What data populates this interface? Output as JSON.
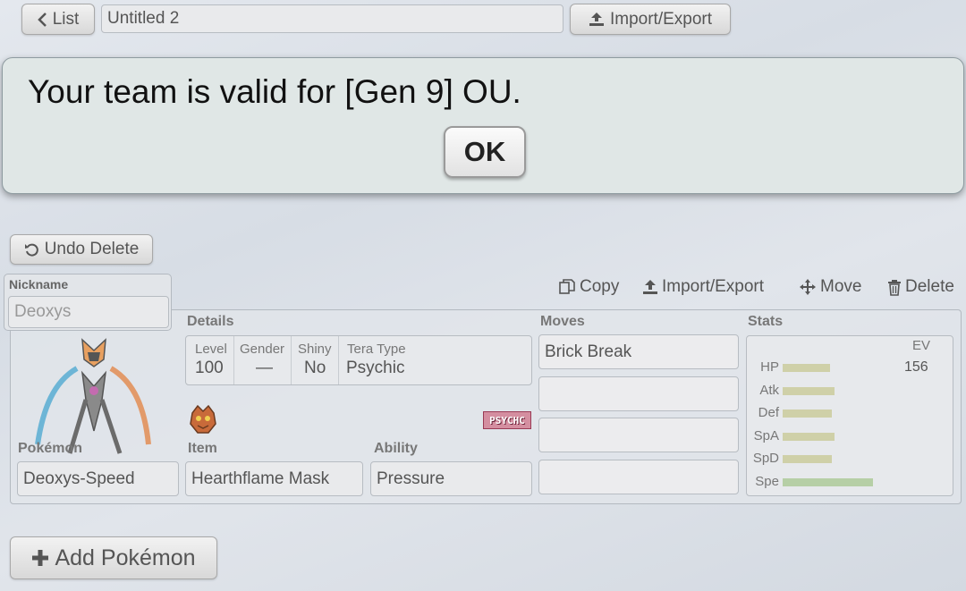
{
  "toolbar": {
    "list_label": "List",
    "team_name": "Untitled 2",
    "import_export_label": "Import/Export"
  },
  "dialog": {
    "message": "Your team is valid for [Gen 9] OU.",
    "ok_label": "OK"
  },
  "undo_label": "Undo Delete",
  "set": {
    "nickname_label": "Nickname",
    "nickname_placeholder": "Deoxys",
    "actions": {
      "copy": "Copy",
      "import_export": "Import/Export",
      "move": "Move",
      "delete": "Delete"
    },
    "details_label": "Details",
    "details": {
      "level_head": "Level",
      "level": "100",
      "gender_head": "Gender",
      "gender": "—",
      "shiny_head": "Shiny",
      "shiny": "No",
      "tera_head": "Tera Type",
      "tera": "Psychic"
    },
    "tera_badge": "PSYCHC",
    "pokemon_label": "Pokémon",
    "pokemon": "Deoxys-Speed",
    "item_label": "Item",
    "item": "Hearthflame Mask",
    "ability_label": "Ability",
    "ability": "Pressure",
    "moves_label": "Moves",
    "moves": [
      "Brick Break",
      "",
      "",
      ""
    ],
    "stats_label": "Stats",
    "ev_label": "EV",
    "stats": [
      {
        "name": "HP",
        "ev": "156",
        "fill": 0.22,
        "color": "#cfd0a8"
      },
      {
        "name": "Atk",
        "ev": "",
        "fill": 0.24,
        "color": "#cfd0a8"
      },
      {
        "name": "Def",
        "ev": "",
        "fill": 0.23,
        "color": "#cfd0a8"
      },
      {
        "name": "SpA",
        "ev": "",
        "fill": 0.24,
        "color": "#cfd0a8"
      },
      {
        "name": "SpD",
        "ev": "",
        "fill": 0.23,
        "color": "#cfd0a8"
      },
      {
        "name": "Spe",
        "ev": "",
        "fill": 0.42,
        "color": "#b6cfa6"
      }
    ]
  },
  "add_pokemon_label": "Add Pokémon"
}
